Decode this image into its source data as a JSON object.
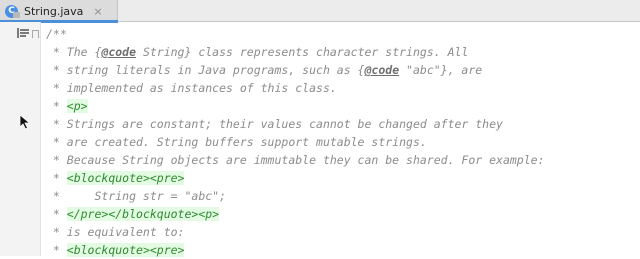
{
  "tab": {
    "icon_letter": "C",
    "label": "String.java",
    "close": "×"
  },
  "editor": {
    "lines": [
      [
        {
          "t": "/**",
          "k": "plain"
        }
      ],
      [
        {
          "t": " * The {",
          "k": "plain"
        },
        {
          "t": "@code",
          "k": "doctag"
        },
        {
          "t": " String} class represents character strings. All",
          "k": "plain"
        }
      ],
      [
        {
          "t": " * string literals in Java programs, such as {",
          "k": "plain"
        },
        {
          "t": "@code",
          "k": "doctag"
        },
        {
          "t": " \"abc\"}, are",
          "k": "plain"
        }
      ],
      [
        {
          "t": " * implemented as instances of this class.",
          "k": "plain"
        }
      ],
      [
        {
          "t": " * ",
          "k": "plain"
        },
        {
          "t": "<p>",
          "k": "tag"
        }
      ],
      [
        {
          "t": " * Strings are constant; their values cannot be changed after they",
          "k": "plain"
        }
      ],
      [
        {
          "t": " * are created. String buffers support mutable strings.",
          "k": "plain"
        }
      ],
      [
        {
          "t": " * Because String objects are immutable they can be shared. For example:",
          "k": "plain"
        }
      ],
      [
        {
          "t": " * ",
          "k": "plain"
        },
        {
          "t": "<blockquote><pre>",
          "k": "tag"
        }
      ],
      [
        {
          "t": " *     String str = \"abc\";",
          "k": "plain"
        }
      ],
      [
        {
          "t": " * ",
          "k": "plain"
        },
        {
          "t": "</pre></blockquote><p>",
          "k": "tag"
        }
      ],
      [
        {
          "t": " * is equivalent to:",
          "k": "plain"
        }
      ],
      [
        {
          "t": " * ",
          "k": "plain"
        },
        {
          "t": "<blockquote><pre>",
          "k": "tag"
        }
      ]
    ]
  },
  "colors": {
    "tab_accent": "#4a90d9",
    "comment_text": "#8c8c8c",
    "html_tag_text": "#2f8a2f",
    "html_tag_bg": "#e3fbe3"
  }
}
